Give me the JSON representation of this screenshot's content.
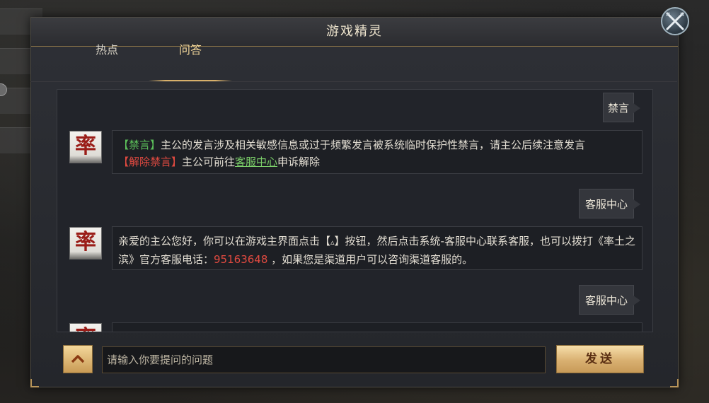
{
  "window": {
    "title": "游戏精灵"
  },
  "tabs": [
    {
      "label": "热点",
      "active": false
    },
    {
      "label": "问答",
      "active": true
    }
  ],
  "avatar_glyph": "率",
  "messages": [
    {
      "question": "禁言",
      "answer": {
        "tag1": "【禁言】",
        "text1": "主公的发言涉及相关敏感信息或过于频繁发言被系统临时保护性禁言，请主公后续注意发言",
        "tag2": "【解除禁言】",
        "text2": "主公可前往",
        "link": "客服中心",
        "text3": "申诉解除"
      }
    },
    {
      "question": "客服中心",
      "answer": {
        "text1": "亲爱的主公您好，你可以在游戏主界面点击【",
        "icon": "▵",
        "text2": "】按钮，然后点击系统-客服中心联系客服，也可以拨打《率土之滨》官方客服电话：",
        "phone": "95163648",
        "text3": " ，如果您是渠道用户可以咨询渠道客服的。"
      }
    },
    {
      "question": "客服中心"
    }
  ],
  "input": {
    "placeholder": "请输入你要提问的问题",
    "value": ""
  },
  "send_label": "发送",
  "icons": {
    "close": "crossed-swords-icon",
    "expand": "chevron-up-icon"
  },
  "colors": {
    "accent_gold": "#d8b06a",
    "tag_green": "#5cc05a",
    "tag_red": "#e04a40"
  }
}
